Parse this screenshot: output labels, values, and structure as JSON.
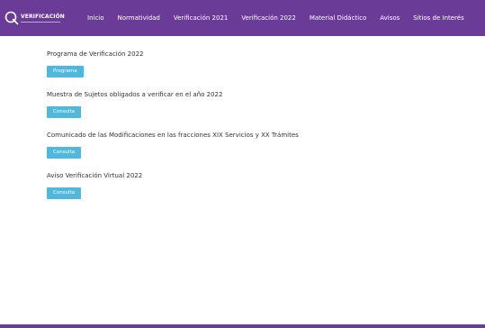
{
  "header": {
    "logo_text": "VERIFICACIÓN",
    "nav": [
      {
        "label": "Inicio"
      },
      {
        "label": "Normatividad"
      },
      {
        "label": "Verificación 2021"
      },
      {
        "label": "Verificación 2022"
      },
      {
        "label": "Material Didáctico"
      },
      {
        "label": "Avisos"
      },
      {
        "label": "Sitios de Interés"
      }
    ]
  },
  "main": {
    "blocks": [
      {
        "title": "Programa de Verificación 2022",
        "button": "Programa"
      },
      {
        "title": "Muestra de Sujetos obligados a verificar en el año 2022",
        "button": "Consulta"
      },
      {
        "title": "Comunicado de las Modificaciones en las fracciones XIX Servicios y XX Trámites",
        "button": "Consulta"
      },
      {
        "title": "Aviso Verificación Virtual 2022",
        "button": "Consulta"
      }
    ]
  },
  "colors": {
    "navbar": "#6a3c97",
    "button": "#4fb8dc",
    "text": "#333333"
  }
}
